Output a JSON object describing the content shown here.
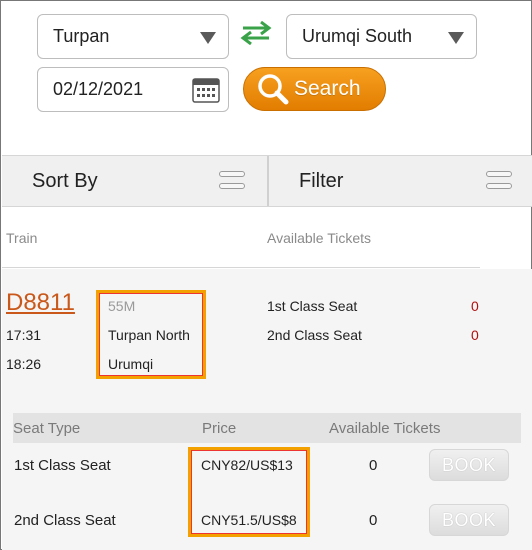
{
  "search": {
    "from": "Turpan",
    "to": "Urumqi South",
    "date": "02/12/2021",
    "search_label": "Search",
    "swap_color": "#3aa34a",
    "button_color": "#f29100"
  },
  "toolbar": {
    "sort_label": "Sort By",
    "filter_label": "Filter"
  },
  "results_header": {
    "train_col": "Train",
    "tickets_col": "Available Tickets"
  },
  "train": {
    "number": "D8811",
    "duration": "55M",
    "depart_time": "17:31",
    "depart_station": "Turpan North",
    "arrive_time": "18:26",
    "arrive_station": "Urumqi",
    "availability": [
      {
        "class": "1st Class Seat",
        "count": "0"
      },
      {
        "class": "2nd Class Seat",
        "count": "0"
      }
    ]
  },
  "seat_table": {
    "headers": {
      "seat_type": "Seat Type",
      "price": "Price",
      "available": "Available Tickets"
    },
    "rows": [
      {
        "seat_type": "1st Class Seat",
        "price": "CNY82/US$13",
        "available": "0",
        "action": "BOOK"
      },
      {
        "seat_type": "2nd Class Seat",
        "price": "CNY51.5/US$8",
        "available": "0",
        "action": "BOOK"
      }
    ]
  }
}
